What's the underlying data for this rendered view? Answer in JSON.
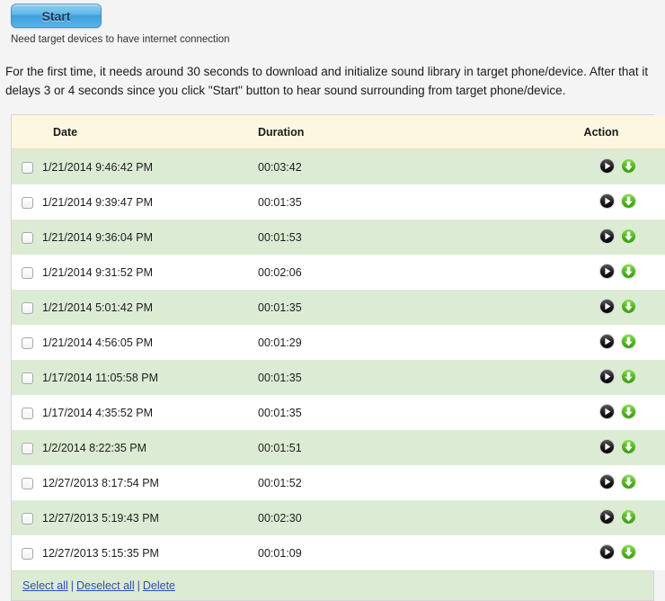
{
  "controls": {
    "start_label": "Start",
    "hint": "Need target devices to have internet connection"
  },
  "intro": {
    "paragraph": "For the first time, it needs around 30 seconds to download and initialize sound library in target phone/device. After that it delays 3 or 4 seconds since you click \"Start\" button to hear sound surrounding from target phone/device."
  },
  "table": {
    "columns": {
      "select": "",
      "date": "Date",
      "duration": "Duration",
      "action": "Action"
    },
    "rows": [
      {
        "date": "1/21/2014 9:46:42 PM",
        "duration": "00:03:42",
        "checked": false
      },
      {
        "date": "1/21/2014 9:39:47 PM",
        "duration": "00:01:35",
        "checked": false
      },
      {
        "date": "1/21/2014 9:36:04 PM",
        "duration": "00:01:53",
        "checked": false
      },
      {
        "date": "1/21/2014 9:31:52 PM",
        "duration": "00:02:06",
        "checked": false
      },
      {
        "date": "1/21/2014 5:01:42 PM",
        "duration": "00:01:35",
        "checked": false
      },
      {
        "date": "1/21/2014 4:56:05 PM",
        "duration": "00:01:29",
        "checked": false
      },
      {
        "date": "1/17/2014 11:05:58 PM",
        "duration": "00:01:35",
        "checked": false
      },
      {
        "date": "1/17/2014 4:35:52 PM",
        "duration": "00:01:35",
        "checked": false
      },
      {
        "date": "1/2/2014 8:22:35 PM",
        "duration": "00:01:51",
        "checked": false
      },
      {
        "date": "12/27/2013 8:17:54 PM",
        "duration": "00:01:52",
        "checked": false
      },
      {
        "date": "12/27/2013 5:19:43 PM",
        "duration": "00:02:30",
        "checked": false
      },
      {
        "date": "12/27/2013 5:15:35 PM",
        "duration": "00:01:09",
        "checked": false
      }
    ],
    "row_actions": {
      "play_label": "play-icon",
      "download_label": "download-icon"
    }
  },
  "footer": {
    "select_all": "Select all",
    "deselect_all": "Deselect all",
    "delete": "Delete",
    "separator": "|"
  },
  "colors": {
    "page_background": "#f4f4f4",
    "header_background": "#fdf6e0",
    "row_alt_background": "#dcecd4",
    "row_base_background": "#ffffff",
    "link": "#2a4fb5",
    "start_button_accent": "#3f9fdc",
    "download_icon_green": "#4caf25",
    "play_icon_dark": "#1a1a1a"
  }
}
